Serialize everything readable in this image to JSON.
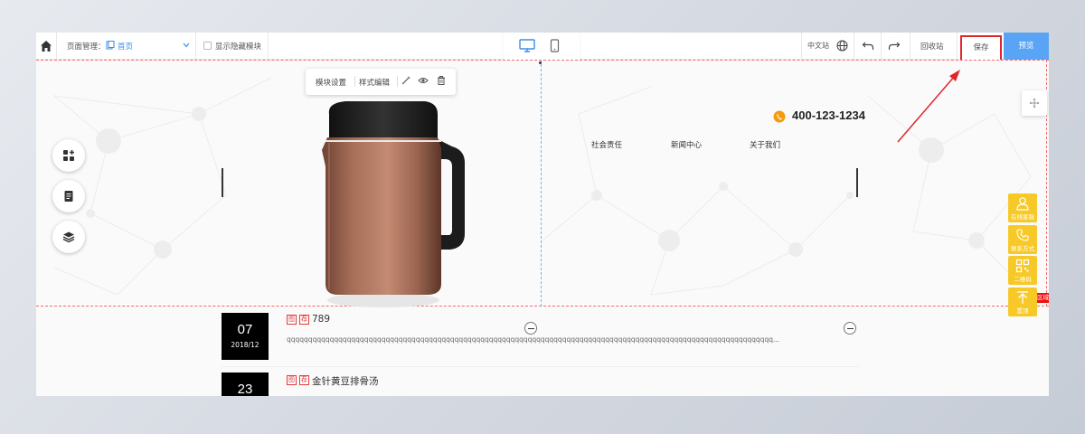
{
  "toolbar": {
    "page_manage_label": "页面管理：",
    "current_page": "首页",
    "show_hidden_label": "显示隐藏模块",
    "lang_label": "中文站",
    "recycle_label": "回收站",
    "save_label": "保存",
    "preview_label": "预览"
  },
  "module_menu": {
    "settings_label": "模块设置",
    "style_label": "样式编辑"
  },
  "header": {
    "phone": "400-123-1234",
    "nav": [
      "社会责任",
      "新闻中心",
      "关于我们"
    ]
  },
  "float_bar": {
    "items": [
      "在线客服",
      "联系方式",
      "二维码",
      "置顶"
    ],
    "tag": "区域"
  },
  "news": [
    {
      "day": "07",
      "ym": "2018/12",
      "tags": [
        "图",
        "荐"
      ],
      "title": "789",
      "summary": "qqqqqqqqqqqqqqqqqqqqqqqqqqqqqqqqqqqqqqqqqqqqqqqqqqqqqqqqqqqqqqqqqqqqqqqqqqqqqqqqqqqqqqqqqqqqqqqqqqqqqqqqqqqqqqqqq..."
    },
    {
      "day": "23",
      "ym": "",
      "tags": [
        "图",
        "荐"
      ],
      "title": "金针黄豆排骨汤",
      "summary": ""
    }
  ],
  "colors": {
    "accent_blue": "#5aa4f6",
    "save_highlight": "#e1262b",
    "float_yellow": "#f7c928",
    "link_blue": "#3a8ee6"
  }
}
